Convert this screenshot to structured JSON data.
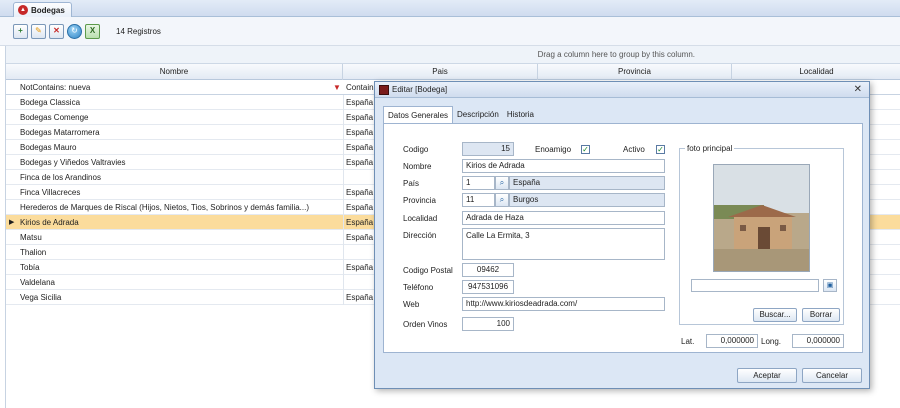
{
  "document_tab": {
    "label": "Bodegas"
  },
  "toolbar": {
    "record_count": "14 Registros"
  },
  "grid": {
    "group_panel_hint": "Drag a column here to group by this column.",
    "columns": [
      "Nombre",
      "Pais",
      "Provincia",
      "Localidad"
    ],
    "filter": {
      "nombre": "NotContains: nueva",
      "pais": "Contains:"
    },
    "rows": [
      {
        "nombre": "Bodega Classica",
        "pais": "España"
      },
      {
        "nombre": "Bodegas Comenge",
        "pais": "España"
      },
      {
        "nombre": "Bodegas Matarromera",
        "pais": "España"
      },
      {
        "nombre": "Bodegas Mauro",
        "pais": "España"
      },
      {
        "nombre": "Bodegas y Viñedos Valtravies",
        "pais": "España"
      },
      {
        "nombre": "Finca de los Arandinos",
        "pais": ""
      },
      {
        "nombre": "Finca Villacreces",
        "pais": "España"
      },
      {
        "nombre": "Herederos de Marques de Riscal (Hijos, Nietos, Tios, Sobrinos y demás familia...)",
        "pais": "España"
      },
      {
        "nombre": "Kirios de Adrada",
        "pais": "España",
        "selected": true
      },
      {
        "nombre": "Matsu",
        "pais": "España"
      },
      {
        "nombre": "Thalion",
        "pais": ""
      },
      {
        "nombre": "Tobía",
        "pais": "España"
      },
      {
        "nombre": "Valdelana",
        "pais": ""
      },
      {
        "nombre": "Vega Sicilia",
        "pais": "España"
      }
    ]
  },
  "dialog": {
    "title": "Editar [Bodega]",
    "tabs": [
      "Datos Generales",
      "Descripción",
      "Historia"
    ],
    "fields": {
      "codigo_label": "Codigo",
      "codigo_value": "15",
      "enoamigo_label": "Enoamigo",
      "enoamigo_checked": true,
      "activo_label": "Activo",
      "activo_checked": true,
      "nombre_label": "Nombre",
      "nombre_value": "Kirios de Adrada",
      "pais_label": "País",
      "pais_id": "1",
      "pais_name": "España",
      "provincia_label": "Provincia",
      "provincia_id": "11",
      "provincia_name": "Burgos",
      "localidad_label": "Localidad",
      "localidad_value": "Adrada de Haza",
      "direccion_label": "Dirección",
      "direccion_value": "Calle La Ermita, 3",
      "cp_label": "Codigo Postal",
      "cp_value": "09462",
      "telefono_label": "Teléfono",
      "telefono_value": "947531096",
      "web_label": "Web",
      "web_value": "http://www.kiriosdeadrada.com/",
      "orden_label": "Orden Vinos",
      "orden_value": "100"
    },
    "photo": {
      "legend": "foto principal",
      "path_value": "",
      "buscar_label": "Buscar...",
      "borrar_label": "Borrar"
    },
    "coords": {
      "lat_label": "Lat.",
      "lat_value": "0,000000",
      "long_label": "Long.",
      "long_value": "0,000000"
    },
    "footer": {
      "aceptar_label": "Aceptar",
      "cancelar_label": "Cancelar"
    }
  },
  "colors": {
    "selected_row": "#fbdc9c",
    "readonly_field": "#dde6f2",
    "dialog_bg": "#dce7f5",
    "accent_check": "#1b8a2e"
  }
}
